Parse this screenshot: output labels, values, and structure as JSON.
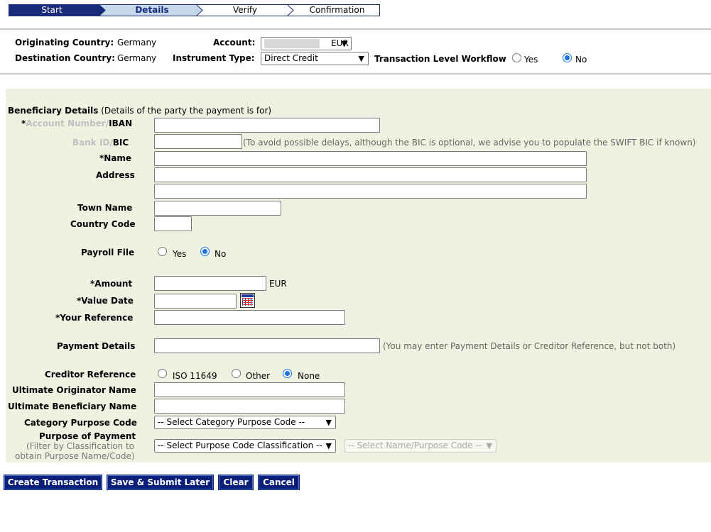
{
  "steps": [
    {
      "label": "Start"
    },
    {
      "label": "Details"
    },
    {
      "label": "Verify"
    },
    {
      "label": "Confirmation"
    }
  ],
  "colors": {
    "step_active": "#1a2a7a",
    "step_current": "#c5d9ea",
    "panel_bg": "#eef3e1",
    "button_bg": "#0a1f7a",
    "radio_on": "#1a73e8"
  },
  "header": {
    "originating_country_label": "Originating Country:",
    "originating_country_value": "Germany",
    "destination_country_label": "Destination Country:",
    "destination_country_value": "Germany",
    "account_label": "Account:",
    "account_value": "EUR",
    "instrument_type_label": "Instrument Type:",
    "instrument_type_value": "Direct Credit",
    "workflow_label": "Transaction Level Workflow",
    "workflow_yes": "Yes",
    "workflow_no": "No",
    "workflow_selected": "No"
  },
  "beneficiary": {
    "section_title": "Beneficiary Details",
    "section_subtitle": "(Details of the party the payment is for)",
    "account_number_star": "*",
    "account_number_label": "Account Number/",
    "iban_label": "IBAN",
    "bank_id_label": "Bank ID/",
    "bic_label": "BIC",
    "bic_note": "(To avoid possible delays, although the BIC is optional, we advise you to populate the SWIFT BIC if known)",
    "name_label": "*Name",
    "address_label": "Address",
    "town_label": "Town Name",
    "country_code_label": "Country Code",
    "payroll_label": "Payroll File",
    "payroll_yes": "Yes",
    "payroll_no": "No",
    "payroll_selected": "No",
    "amount_label": "*Amount",
    "amount_currency": "EUR",
    "value_date_label": "*Value Date",
    "your_reference_label": "*Your Reference",
    "payment_details_label": "Payment Details",
    "payment_details_note": "(You may enter Payment Details or Creditor Reference, but not both)",
    "creditor_reference_label": "Creditor Reference",
    "creditor_options": [
      "ISO 11649",
      "Other",
      "None"
    ],
    "creditor_selected": "None",
    "ultimate_originator_label": "Ultimate Originator Name",
    "ultimate_beneficiary_label": "Ultimate Beneficiary Name",
    "category_purpose_label": "Category Purpose Code",
    "category_purpose_value": "-- Select Category Purpose Code --",
    "purpose_of_payment_label": "Purpose of Payment",
    "purpose_filter_note_1": "(Filter by Classification to",
    "purpose_filter_note_2": "obtain Purpose Name/Code)",
    "purpose_classification_value": "-- Select Purpose Code Classification --",
    "purpose_name_value": "-- Select Name/Purpose Code --"
  },
  "buttons": {
    "create": "Create Transaction",
    "save_later": "Save & Submit Later",
    "clear": "Clear",
    "cancel": "Cancel"
  }
}
